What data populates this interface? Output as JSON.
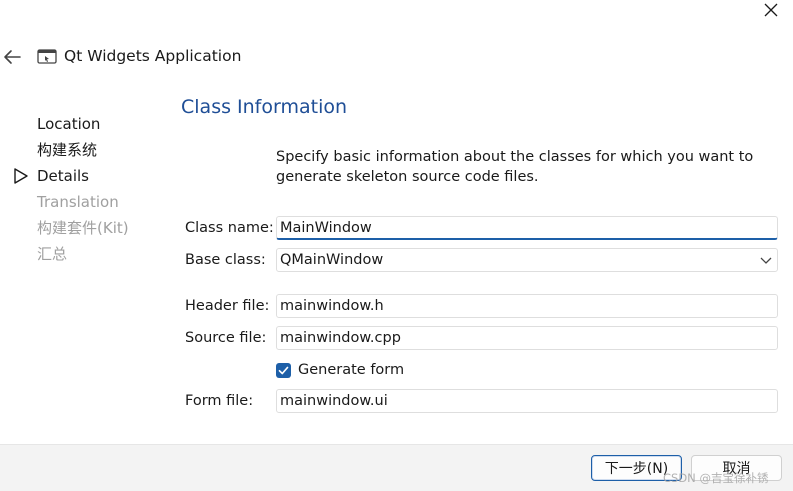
{
  "header": {
    "title": "Qt Widgets Application"
  },
  "steps": [
    {
      "label": "Location",
      "state": "done"
    },
    {
      "label": "构建系统",
      "state": "done"
    },
    {
      "label": "Details",
      "state": "current"
    },
    {
      "label": "Translation",
      "state": "pending"
    },
    {
      "label": "构建套件(Kit)",
      "state": "pending"
    },
    {
      "label": "汇总",
      "state": "pending"
    }
  ],
  "main": {
    "section_title": "Class Information",
    "description": "Specify basic information about the classes for which you want to generate skeleton source code files.",
    "fields": {
      "class_name": {
        "label": "Class name:",
        "value": "MainWindow"
      },
      "base_class": {
        "label": "Base class:",
        "value": "QMainWindow"
      },
      "header_file": {
        "label": "Header file:",
        "value": "mainwindow.h"
      },
      "source_file": {
        "label": "Source file:",
        "value": "mainwindow.cpp"
      },
      "form_file": {
        "label": "Form file:",
        "value": "mainwindow.ui"
      }
    },
    "generate_form": {
      "label": "Generate form",
      "checked": true
    }
  },
  "footer": {
    "next_label": "下一步(N)",
    "cancel_label": "取消"
  },
  "watermark": "CSDN @吉宝徐补锈",
  "colors": {
    "accent": "#1d5fa8",
    "title_blue": "#1f4e96",
    "pending_text": "#a0a0a0",
    "footer_bg": "#f3f3f3"
  },
  "icons": {
    "close": "close-icon",
    "back": "back-arrow-icon",
    "app": "qt-window-icon",
    "current_step": "triangle-right-icon",
    "dropdown": "chevron-down-icon",
    "check": "checkmark-icon"
  }
}
